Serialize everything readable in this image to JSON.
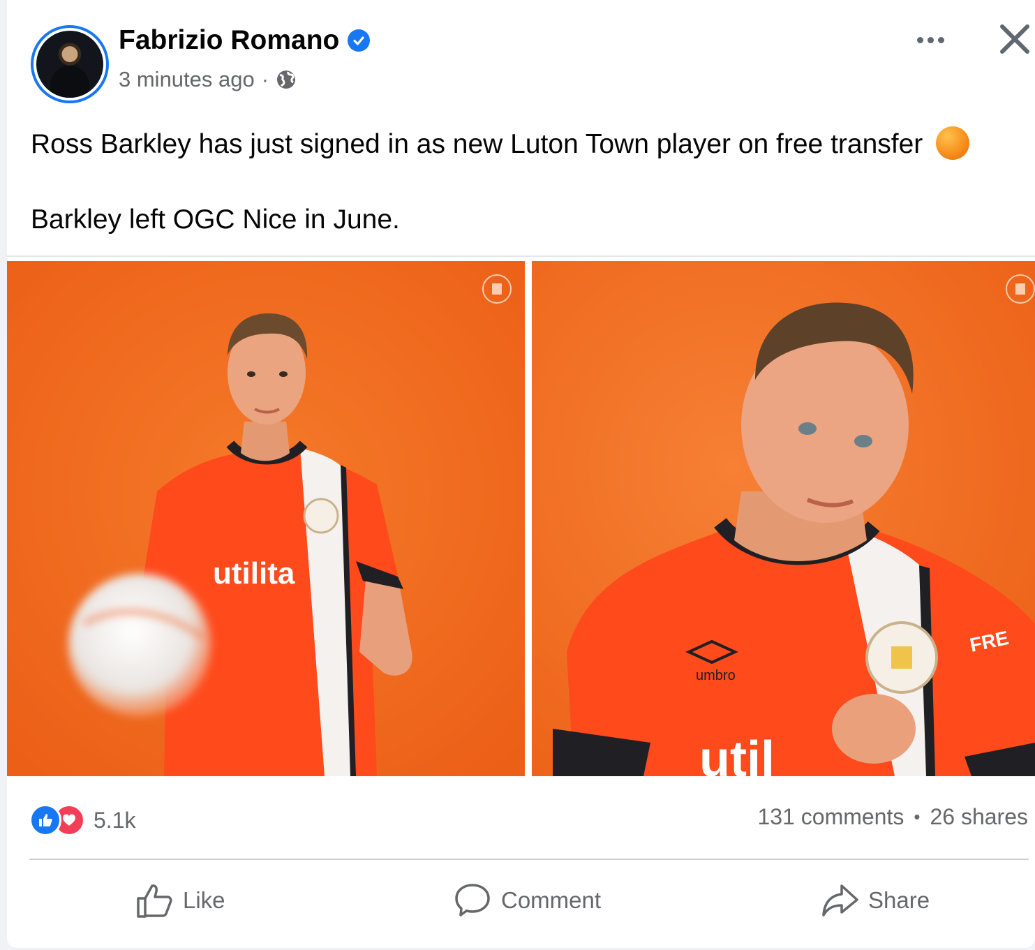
{
  "post": {
    "author": "Fabrizio Romano",
    "verified": true,
    "timestamp": "3 minutes ago",
    "separator": "·",
    "audience_icon": "globe-icon",
    "text_line1": "Ross Barkley has just signed in as new Luton Town player on free transfer",
    "text_line2": "Barkley left OGC Nice in June.",
    "emoji": "orange-circle"
  },
  "media": {
    "images": [
      {
        "label": "Ross Barkley in Luton Town kit holding ball"
      },
      {
        "label": "Ross Barkley close-up in Luton Town kit"
      }
    ],
    "shirt_sponsor": "utilita",
    "shirt_brand": "umbro",
    "club_crest": "LUTON TOWN FOOTBALL CLUB"
  },
  "engagement": {
    "reaction_icons": [
      "like-reaction-icon",
      "love-reaction-icon"
    ],
    "reaction_count": "5.1k",
    "comments": "131 comments",
    "dot": "•",
    "shares": "26 shares"
  },
  "actions": {
    "like": "Like",
    "comment": "Comment",
    "share": "Share"
  },
  "colors": {
    "brand_blue": "#1877f2",
    "love_red": "#f33e58",
    "photo_orange": "#f26a1f",
    "secondary_text": "#65676b"
  }
}
